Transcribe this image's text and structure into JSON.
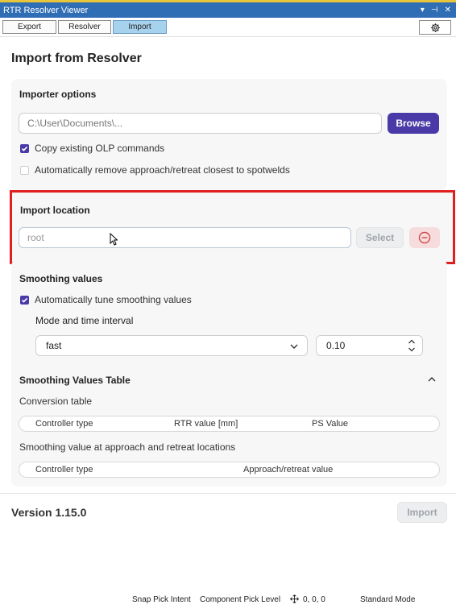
{
  "window": {
    "title": "RTR Resolver Viewer",
    "controls": [
      "▾",
      "⊣",
      "✕"
    ]
  },
  "tabs": [
    {
      "label": "Export",
      "active": false
    },
    {
      "label": "Resolver",
      "active": false
    },
    {
      "label": "Import",
      "active": true
    }
  ],
  "settings_icon": "gear-icon",
  "page": {
    "title": "Import from Resolver"
  },
  "importer_options": {
    "title": "Importer options",
    "path_placeholder": "C:\\User\\Documents\\...",
    "browse_label": "Browse",
    "copy_olp": {
      "label": "Copy existing OLP commands",
      "checked": true
    },
    "auto_remove": {
      "label": "Automatically remove approach/retreat closest to spotwelds",
      "checked": false
    }
  },
  "import_location": {
    "title": "Import location",
    "placeholder": "root",
    "select_label": "Select",
    "remove_icon": "minus-circle-icon"
  },
  "smoothing": {
    "title": "Smoothing values",
    "auto_tune": {
      "label": "Automatically tune smoothing values",
      "checked": true
    },
    "mode_label": "Mode and time interval",
    "mode_value": "fast",
    "interval_value": "0.10"
  },
  "smoothing_table": {
    "title": "Smoothing Values Table",
    "conversion_label": "Conversion table",
    "conversion_columns": [
      "Controller type",
      "RTR value [mm]",
      "PS Value"
    ],
    "approach_label": "Smoothing value at approach and retreat locations",
    "approach_columns": [
      "Controller type",
      "Approach/retreat value"
    ]
  },
  "footer": {
    "version": "Version 1.15.0",
    "import_label": "Import"
  },
  "statusbar": {
    "snap": "Snap Pick Intent",
    "component": "Component Pick Level",
    "coords": "0, 0, 0",
    "mode": "Standard Mode"
  },
  "colors": {
    "accent": "#4a3aa8",
    "highlight": "#e02020",
    "titlebar": "#2f6db5",
    "active_tab": "#a7d2ee"
  }
}
